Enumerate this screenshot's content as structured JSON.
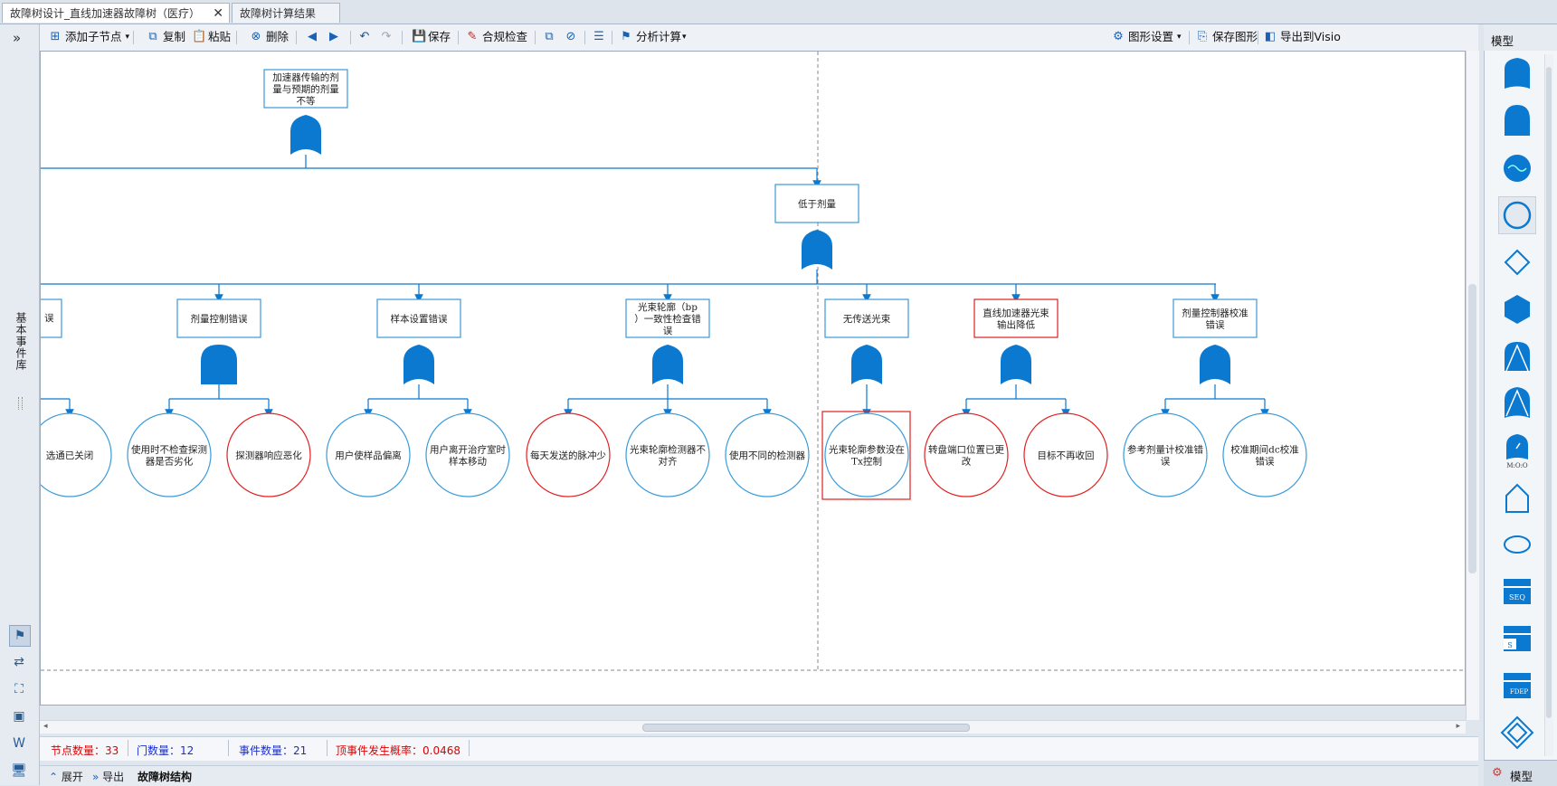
{
  "tabs": [
    {
      "label": "故障树设计_直线加速器故障树（医疗）"
    },
    {
      "label": "故障树计算结果"
    }
  ],
  "toolbar": {
    "collapse": "»",
    "add_child": "添加子节点",
    "copy": "复制",
    "paste": "粘贴",
    "delete": "删除",
    "save": "保存",
    "compliance": "合规检查",
    "analysis": "分析计算",
    "graph_settings": "图形设置",
    "save_graph": "保存图形",
    "export_visio": "导出到Visio"
  },
  "left_panel": {
    "label": "基本事件库"
  },
  "palette": {
    "title": "模型",
    "tab_label": "模型",
    "items": [
      "or-gate-shape",
      "and-gate-shape",
      "xor-gate-shape",
      "basic-event-shape",
      "undeveloped-event-shape",
      "hexagon-inhibit-shape",
      "priority-and-shape",
      "priority-or-shape",
      "voting-gate-shape",
      "house-event-shape",
      "conditional-event-shape",
      "seq-gate-shape",
      "spare-gate-shape",
      "fdep-gate-shape",
      "transfer-shape"
    ],
    "labels": {
      "vote": "M:O:O",
      "seq": "SEQ",
      "spare": "S",
      "fdep": "FDEP"
    }
  },
  "tree": {
    "top": "加速器传输的剂量与预期的剂量不等",
    "low_dose": "低于剂量",
    "partial_left": "误",
    "mid": [
      "剂量控制错误",
      "样本设置错误",
      "光束轮廓（bp）一致性检查错误",
      "无传送光束",
      "直线加速器光束输出降低",
      "剂量控制器校准错误"
    ],
    "events": [
      "选通已关闭",
      "使用时不检查探测器是否劣化",
      "探测器响应恶化",
      "用户使样品偏离",
      "用户离开治疗室时样本移动",
      "每天发送的脉冲少",
      "光束轮廓检测器不对齐",
      "使用不同的检测器",
      "光束轮廓参数没在Tx控制",
      "转盘端口位置已更改",
      "目标不再收回",
      "参考剂量计校准错误",
      "校准期间dc校准错误"
    ]
  },
  "status": {
    "nodes_label": "节点数量：",
    "nodes_value": "33",
    "gates_label": "门数量：",
    "gates_value": "12",
    "events_label": "事件数量：",
    "events_value": "21",
    "prob_label": "顶事件发生概率：",
    "prob_value": "0.0468"
  },
  "bottom": {
    "expand": "展开",
    "export": "导出",
    "structure": "故障树结构"
  },
  "colors": {
    "accent": "#0b79d0",
    "node_border": "#3a9ad9",
    "highlight": "#e02020",
    "status_red": "#e00000",
    "status_blue": "#1a2fcf"
  }
}
